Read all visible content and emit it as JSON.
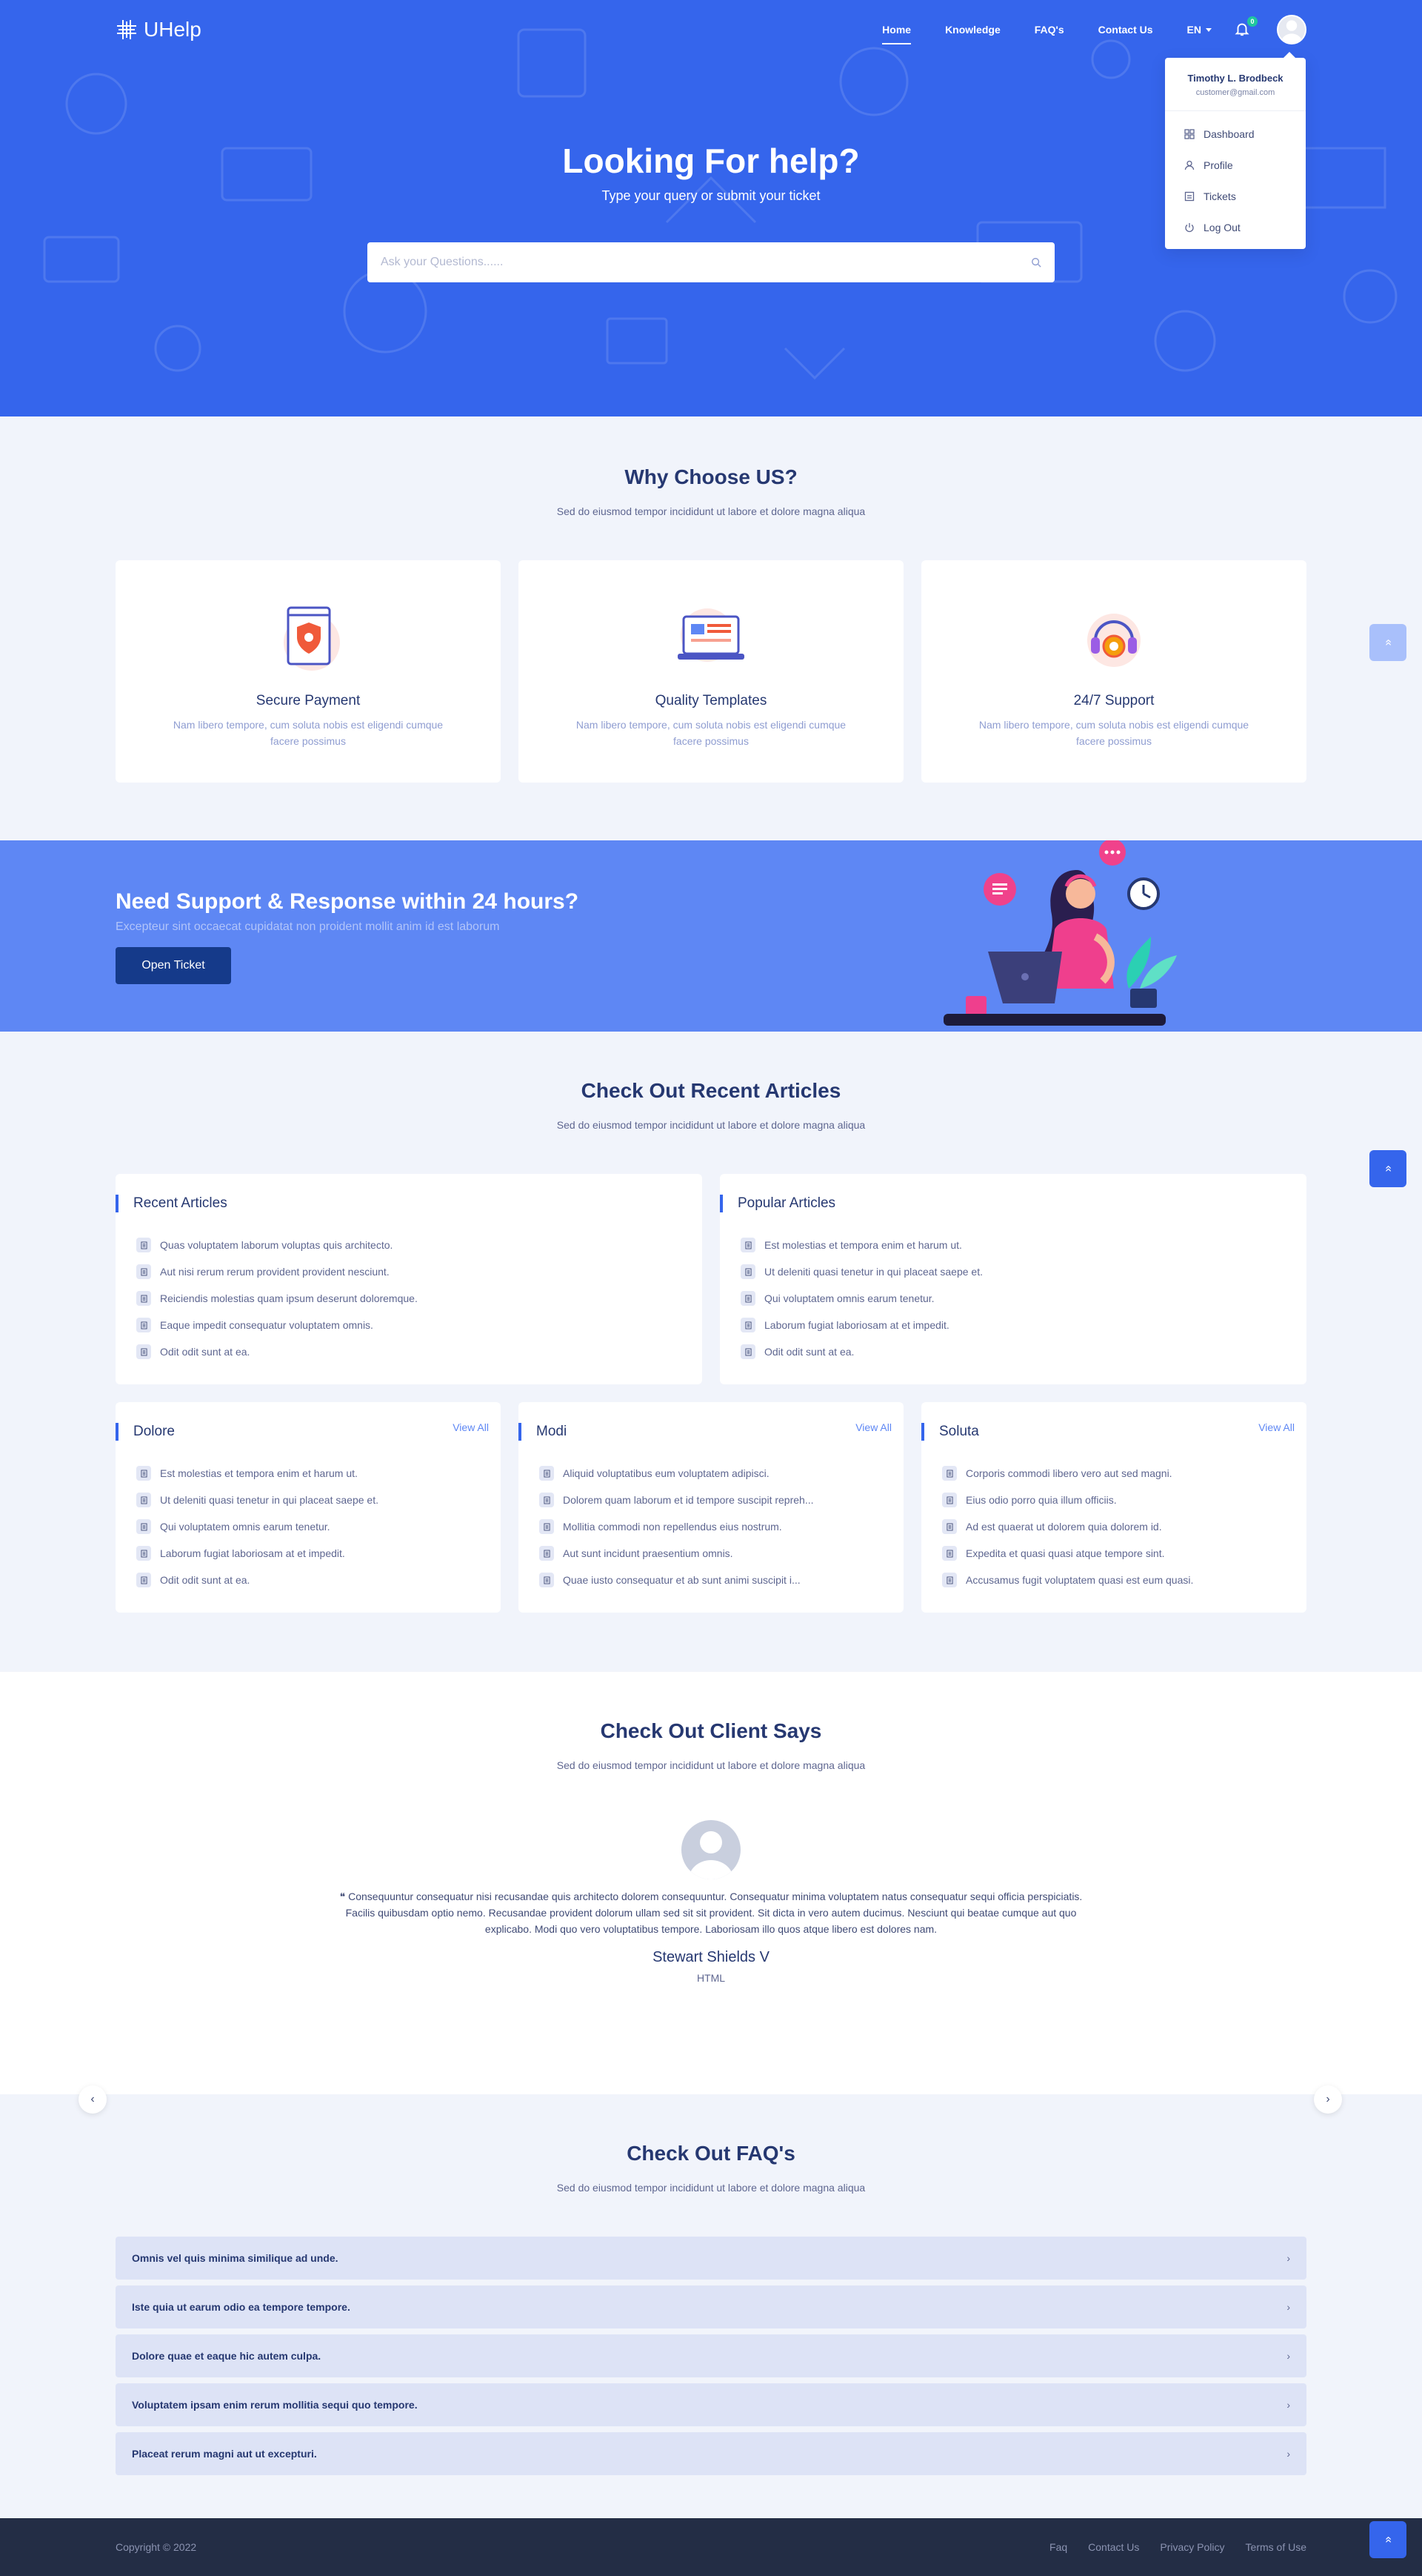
{
  "header": {
    "brand": "UHelp",
    "nav": [
      "Home",
      "Knowledge",
      "FAQ's",
      "Contact Us"
    ],
    "language": "EN",
    "notification_count": "0"
  },
  "user_menu": {
    "name": "Timothy L. Brodbeck",
    "email": "customer@gmail.com",
    "items": [
      "Dashboard",
      "Profile",
      "Tickets",
      "Log Out"
    ]
  },
  "hero": {
    "title": "Looking For help?",
    "subtitle": "Type your query or submit your ticket",
    "search_placeholder": "Ask your Questions......"
  },
  "why": {
    "title": "Why Choose US?",
    "subtitle": "Sed do eiusmod tempor incididunt ut labore et dolore magna aliqua",
    "cards": [
      {
        "title": "Secure Payment",
        "text": "Nam libero tempore, cum soluta nobis est eligendi cumque facere possimus"
      },
      {
        "title": "Quality Templates",
        "text": "Nam libero tempore, cum soluta nobis est eligendi cumque facere possimus"
      },
      {
        "title": "24/7 Support",
        "text": "Nam libero tempore, cum soluta nobis est eligendi cumque facere possimus"
      }
    ]
  },
  "support": {
    "title": "Need Support & Response within 24 hours?",
    "text": "Excepteur sint occaecat cupidatat non proident mollit anim id est laborum",
    "button": "Open Ticket"
  },
  "articles": {
    "title": "Check Out Recent Articles",
    "subtitle": "Sed do eiusmod tempor incididunt ut labore et dolore magna aliqua",
    "view_all": "View All",
    "recent": {
      "title": "Recent Articles",
      "items": [
        "Quas voluptatem laborum voluptas quis architecto.",
        "Aut nisi rerum rerum provident provident nesciunt.",
        "Reiciendis molestias quam ipsum deserunt doloremque.",
        "Eaque impedit consequatur voluptatem omnis.",
        "Odit odit sunt at ea."
      ]
    },
    "popular": {
      "title": "Popular Articles",
      "items": [
        "Est molestias et tempora enim et harum ut.",
        "Ut deleniti quasi tenetur in qui placeat saepe et.",
        "Qui voluptatem omnis earum tenetur.",
        "Laborum fugiat laboriosam at et impedit.",
        "Odit odit sunt at ea."
      ]
    },
    "dolore": {
      "title": "Dolore",
      "items": [
        "Est molestias et tempora enim et harum ut.",
        "Ut deleniti quasi tenetur in qui placeat saepe et.",
        "Qui voluptatem omnis earum tenetur.",
        "Laborum fugiat laboriosam at et impedit.",
        "Odit odit sunt at ea."
      ]
    },
    "modi": {
      "title": "Modi",
      "items": [
        "Aliquid voluptatibus eum voluptatem adipisci.",
        "Dolorem quam laborum et id tempore suscipit repreh...",
        "Mollitia commodi non repellendus eius nostrum.",
        "Aut sunt incidunt praesentium omnis.",
        "Quae iusto consequatur et ab sunt animi suscipit i..."
      ]
    },
    "soluta": {
      "title": "Soluta",
      "items": [
        "Corporis commodi libero vero aut sed magni.",
        "Eius odio porro quia illum officiis.",
        "Ad est quaerat ut dolorem quia dolorem id.",
        "Expedita et quasi quasi atque tempore sint.",
        "Accusamus fugit voluptatem quasi est eum quasi."
      ]
    }
  },
  "client": {
    "title": "Check Out Client Says",
    "subtitle": "Sed do eiusmod tempor incididunt ut labore et dolore magna aliqua",
    "quote": "Consequuntur consequatur nisi recusandae quis architecto dolorem consequuntur. Consequatur minima voluptatem natus consequatur sequi officia perspiciatis. Facilis quibusdam optio nemo. Recusandae provident dolorum ullam sed sit sit provident. Sit dicta in vero autem ducimus. Nesciunt qui beatae cumque aut quo explicabo. Modi quo vero voluptatibus tempore. Laboriosam illo quos atque libero est dolores nam.",
    "name": "Stewart Shields V",
    "role": "HTML"
  },
  "faq": {
    "title": "Check Out FAQ's",
    "subtitle": "Sed do eiusmod tempor incididunt ut labore et dolore magna aliqua",
    "items": [
      "Omnis vel quis minima similique ad unde.",
      "Iste quia ut earum odio ea tempore tempore.",
      "Dolore quae et eaque hic autem culpa.",
      "Voluptatem ipsam enim rerum mollitia sequi quo tempore.",
      "Placeat rerum magni aut ut excepturi."
    ]
  },
  "footer": {
    "copyright": "Copyright © 2022",
    "links": [
      "Faq",
      "Contact Us",
      "Privacy Policy",
      "Terms of Use"
    ]
  },
  "colors": {
    "primary": "#3565ec",
    "banner": "#5e87f4",
    "button_dark": "#153a8a",
    "footer": "#232d45",
    "badge": "#1fc69f"
  }
}
